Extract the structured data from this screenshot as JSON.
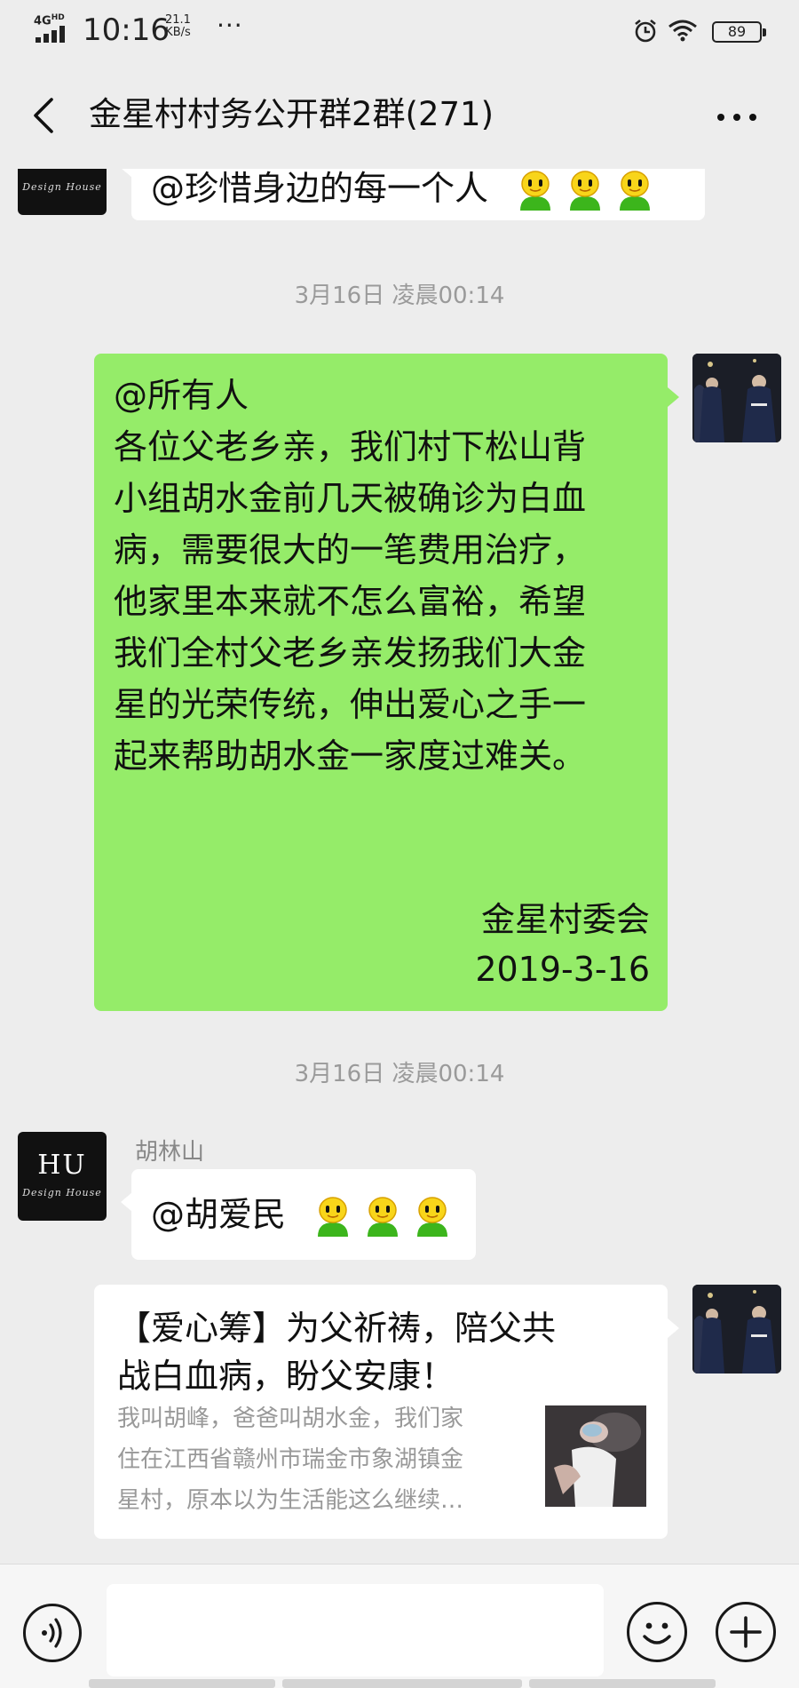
{
  "status_bar": {
    "network": "4G",
    "network_suffix": "HD",
    "time": "10:16",
    "speed_value": "21.1",
    "speed_unit": "KB/s",
    "more": "···",
    "battery": "89",
    "icons": [
      "signal-icon",
      "alarm-icon",
      "wifi-icon",
      "battery-icon"
    ]
  },
  "header": {
    "title": "金星村村务公开群2群(271)",
    "back_icon": "chevron-left-icon",
    "more_icon": "more-dots-icon"
  },
  "messages": [
    {
      "type": "text",
      "side": "left",
      "text": "@珍惜身边的每一个人",
      "emoji": [
        "emoji-icon",
        "emoji-icon",
        "emoji-icon"
      ]
    },
    {
      "type": "timestamp",
      "text": "3月16日 凌晨00:14"
    },
    {
      "type": "text",
      "side": "right",
      "lines": [
        "@所有人",
        "各位父老乡亲，我们村下松山背",
        "小组胡水金前几天被确诊为白血",
        "病，需要很大的一笔费用治疗，",
        "他家里本来就不怎么富裕，希望",
        "我们全村父老乡亲发扬我们大金",
        "星的光荣传统，伸出爱心之手一",
        "起来帮助胡水金一家度过难关。"
      ],
      "signature": "金星村委会",
      "date": "2019-3-16"
    },
    {
      "type": "timestamp",
      "text": "3月16日 凌晨00:14"
    },
    {
      "type": "text",
      "side": "left",
      "sender": "胡林山",
      "avatar_text": "HU",
      "avatar_subtext": "Design House",
      "text": "@胡爱民",
      "emoji": [
        "emoji-icon",
        "emoji-icon",
        "emoji-icon"
      ]
    },
    {
      "type": "share_card",
      "side": "right",
      "title_lines": [
        "【爱心筹】为父祈祷，陪父共",
        "战白血病，盼父安康！"
      ],
      "desc_lines": [
        "我叫胡峰，爸爸叫胡水金，我们家",
        "住在江西省赣州市瑞金市象湖镇金",
        "星村，原本以为生活能这么继续…"
      ]
    }
  ],
  "input_bar": {
    "voice_icon": "voice-icon",
    "emoji_icon": "emoji-face-icon",
    "plus_icon": "plus-icon",
    "value": ""
  },
  "colors": {
    "background": "#ededed",
    "green_bubble": "#95ec69",
    "white_bubble": "#ffffff",
    "timestamp": "#9a9a9a"
  }
}
